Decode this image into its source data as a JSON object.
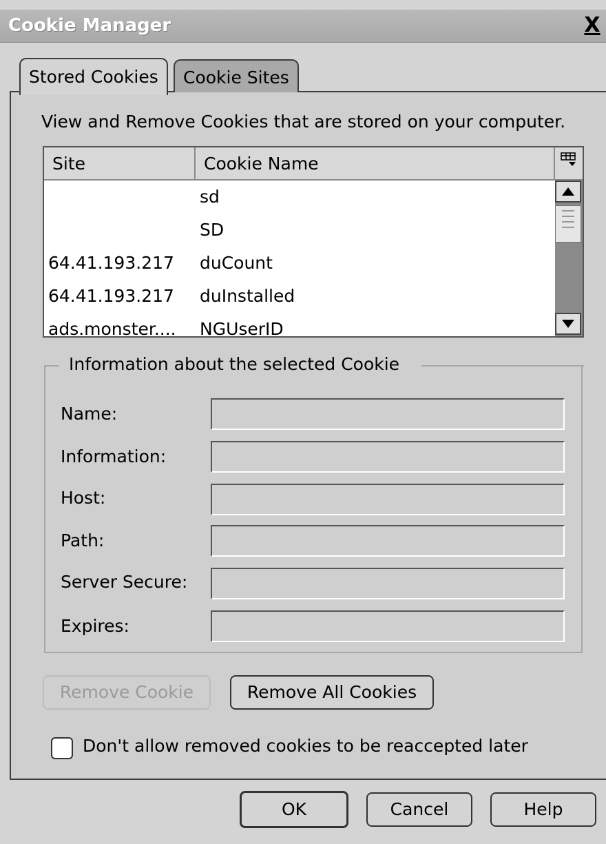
{
  "window": {
    "title": "Cookie Manager",
    "close_glyph": "X"
  },
  "tabs": [
    {
      "label": "Stored Cookies",
      "selected": true
    },
    {
      "label": "Cookie Sites",
      "selected": false
    }
  ],
  "description": "View and Remove Cookies that are stored on your computer.",
  "cookie_list": {
    "columns": [
      "Site",
      "Cookie Name"
    ],
    "column_picker_icon": "column-picker-icon",
    "rows": [
      {
        "site": "",
        "name": "sd"
      },
      {
        "site": "",
        "name": "SD"
      },
      {
        "site": "64.41.193.217",
        "name": "duCount"
      },
      {
        "site": "64.41.193.217",
        "name": "duInstalled"
      },
      {
        "site": "ads.monster....",
        "name": "NGUserID"
      }
    ]
  },
  "info_group": {
    "legend": "Information about the selected Cookie",
    "fields": [
      {
        "label": "Name:",
        "value": ""
      },
      {
        "label": "Information:",
        "value": ""
      },
      {
        "label": "Host:",
        "value": ""
      },
      {
        "label": "Path:",
        "value": ""
      },
      {
        "label": "Server Secure:",
        "value": ""
      },
      {
        "label": "Expires:",
        "value": ""
      }
    ]
  },
  "actions": {
    "remove_cookie": "Remove Cookie",
    "remove_all": "Remove All Cookies"
  },
  "checkbox": {
    "label": "Don't allow removed cookies to be reaccepted later",
    "checked": false
  },
  "footer": {
    "ok": "OK",
    "cancel": "Cancel",
    "help": "Help"
  },
  "colors": {
    "title_bar": "#a9a9a9",
    "dialog_bg": "#d4d4d4",
    "disabled_text": "#9a9a9a"
  }
}
